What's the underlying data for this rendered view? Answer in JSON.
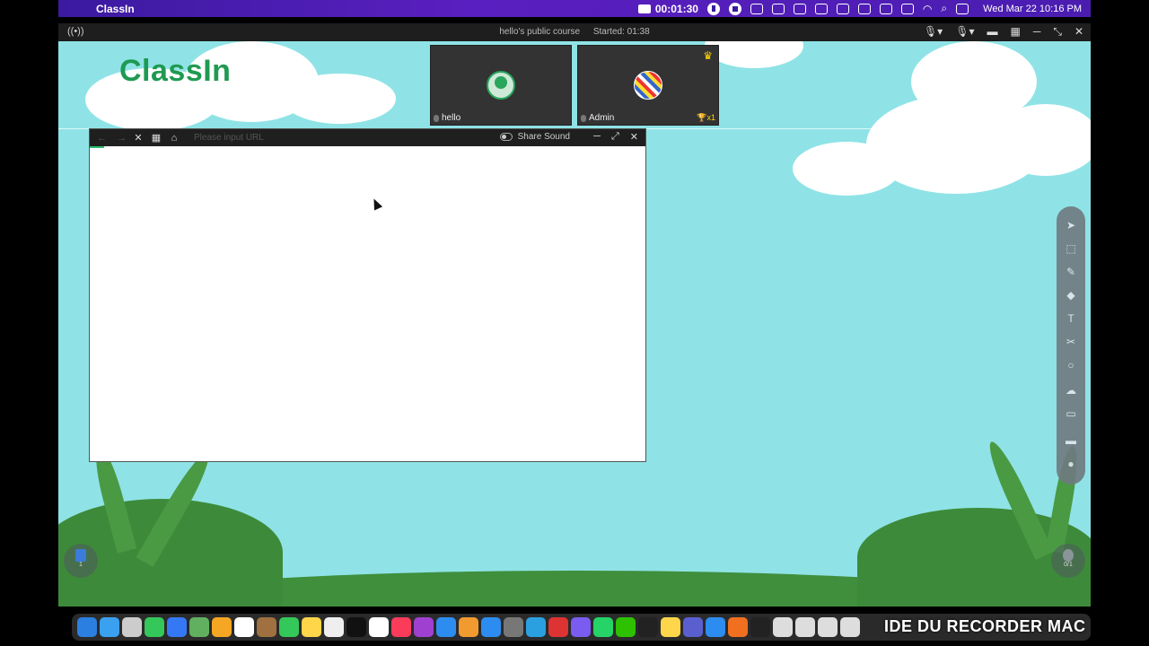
{
  "menubar": {
    "app_name": "ClassIn",
    "record_time": "00:01:30",
    "datetime": "Wed Mar 22  10:16 PM"
  },
  "window": {
    "course_title": "hello's public course",
    "started": "Started: 01:38"
  },
  "classroom": {
    "logo": "ClassIn",
    "videos": [
      {
        "name": "hello"
      },
      {
        "name": "Admin",
        "trophy": "x1"
      }
    ],
    "browser": {
      "url_placeholder": "Please input URL",
      "share_sound": "Share Sound"
    },
    "left_badge": "1",
    "right_badge": "0/1"
  },
  "dock": {
    "watermark": "IDE DU RECORDER MAC"
  },
  "colors": {
    "menubar": "#4a1db0",
    "sky": "#8fe3e6",
    "grass": "#3f8f3c",
    "logo": "#1f9a52"
  }
}
